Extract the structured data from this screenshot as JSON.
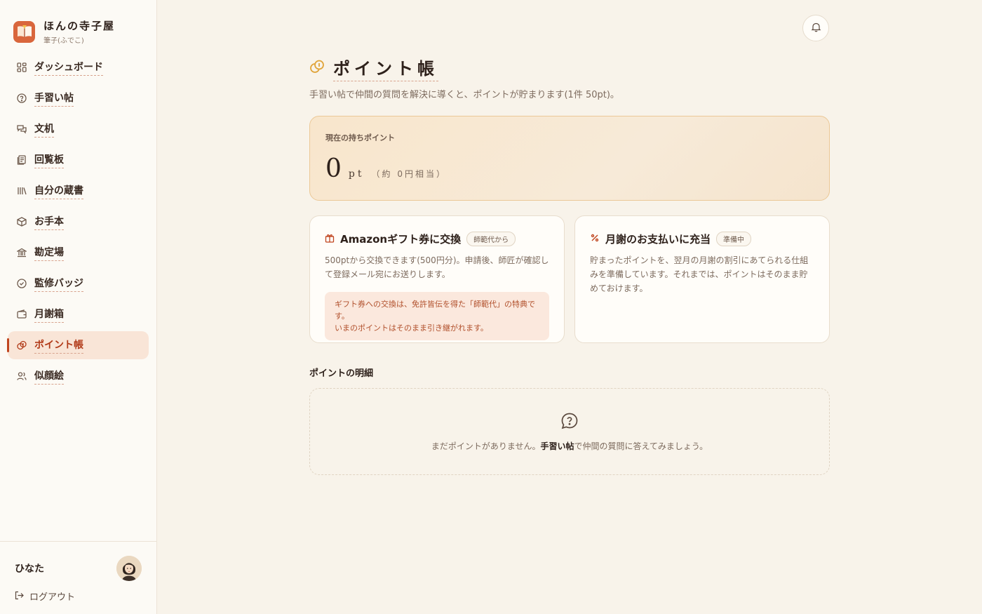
{
  "brand": {
    "title": "ほんの寺子屋",
    "subtitle": "筆子(ふでこ)"
  },
  "nav": [
    {
      "id": "dashboard",
      "label": "ダッシュボード",
      "icon": "grid-icon",
      "active": false
    },
    {
      "id": "tenarai",
      "label": "手習い帖",
      "icon": "help-circle-icon",
      "active": false
    },
    {
      "id": "fuzukue",
      "label": "文机",
      "icon": "chat-icon",
      "active": false
    },
    {
      "id": "kairanban",
      "label": "回覧板",
      "icon": "document-icon",
      "active": false
    },
    {
      "id": "library",
      "label": "自分の蔵書",
      "icon": "library-icon",
      "active": false
    },
    {
      "id": "otehon",
      "label": "お手本",
      "icon": "box-icon",
      "active": false
    },
    {
      "id": "kanjoba",
      "label": "勘定場",
      "icon": "bank-icon",
      "active": false
    },
    {
      "id": "badge",
      "label": "監修バッジ",
      "icon": "check-badge-icon",
      "active": false
    },
    {
      "id": "gessha",
      "label": "月謝箱",
      "icon": "wallet-icon",
      "active": false
    },
    {
      "id": "points",
      "label": "ポイント帳",
      "icon": "coins-icon",
      "active": true
    },
    {
      "id": "nigaoe",
      "label": "似顔絵",
      "icon": "users-icon",
      "active": false
    }
  ],
  "user": {
    "name": "ひなた",
    "logout_label": "ログアウト"
  },
  "page": {
    "title": "ポイント帳",
    "description": "手習い帖で仲間の質問を解決に導くと、ポイントが貯まります(1件 50pt)。"
  },
  "balance": {
    "label": "現在の持ちポイント",
    "value": "0",
    "unit": "pt",
    "yen_equivalent": "（約 0円相当）"
  },
  "cards": {
    "amazon": {
      "title": "Amazonギフト券に交換",
      "chip": "師範代から",
      "text": "500ptから交換できます(500円分)。申請後、師匠が確認して登録メール宛にお送りします。",
      "notice_line1": "ギフト券への交換は、免許皆伝を得た「師範代」の特典です。",
      "notice_line2": "いまのポイントはそのまま引き継がれます。"
    },
    "tuition": {
      "title": "月謝のお支払いに充当",
      "chip": "準備中",
      "text": "貯まったポイントを、翌月の月謝の割引にあてられる仕組みを準備しています。それまでは、ポイントはそのまま貯めておけます。"
    }
  },
  "history": {
    "title": "ポイントの明細",
    "empty_prefix": "まだポイントがありません。",
    "empty_link": "手習い帖",
    "empty_suffix": "で仲間の質問に答えてみましょう。"
  },
  "colors": {
    "accent": "#c0451f",
    "brand": "#d9663c",
    "gold": "#e0a43a"
  }
}
